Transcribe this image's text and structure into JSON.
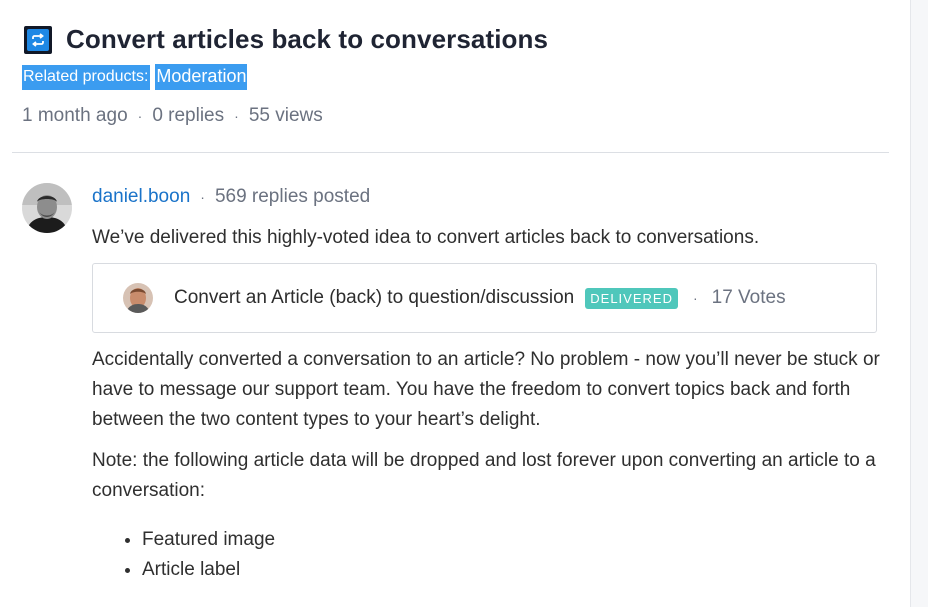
{
  "post": {
    "title": "Convert articles back to conversations",
    "title_icon": "repeat-arrows-icon",
    "related_label": "Related products:",
    "related_tag": "Moderation",
    "posted": "1 month ago",
    "replies": "0 replies",
    "views": "55 views"
  },
  "reply": {
    "author": "daniel.boon",
    "author_stats": "569 replies posted",
    "intro": "We’ve delivered this highly-voted idea to convert articles back to conversations.",
    "idea_card": {
      "title": "Convert an Article (back) to question/discussion",
      "status": "DELIVERED",
      "votes": "17 Votes"
    },
    "paragraphs": [
      "Accidentally converted a conversation to an article? No problem - now you’ll never be stuck or have to message our support team. You have the freedom to convert topics back and forth between the two content types to your heart’s delight.",
      "Note: the following article data will be dropped and lost forever upon converting an article to a conversation:"
    ],
    "bullets": [
      "Featured image",
      "Article label"
    ]
  },
  "separator": "·",
  "colors": {
    "title": "#1f2433",
    "link": "#1a73c9",
    "highlight": "#3b9cf0",
    "delivered_badge": "#4fc7bb",
    "muted": "#6b7280"
  }
}
